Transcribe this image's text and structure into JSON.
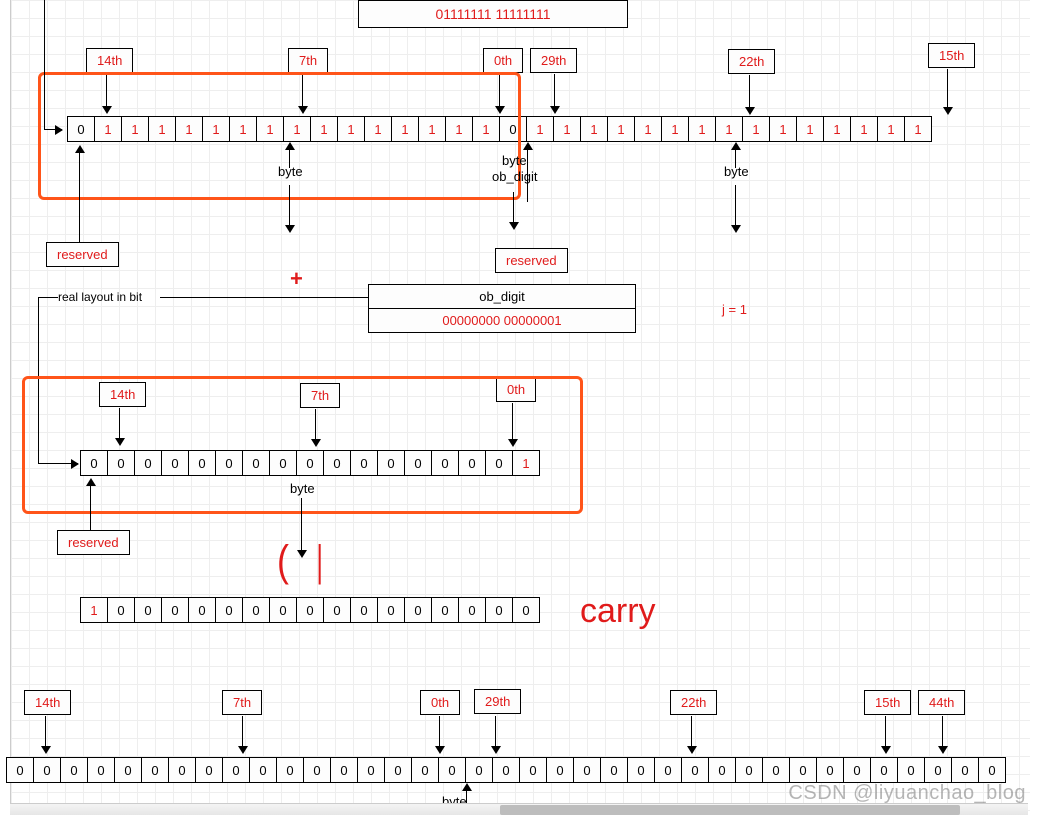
{
  "top_bin_box": "01111111 11111111",
  "ob_digit_label": "ob_digit",
  "ob_digit_value2": "00000000 00000001",
  "real_layout_label": "real layout in bit",
  "byte_label": "byte",
  "byte_obdigit_label1": "byte",
  "byte_obdigit_label2": "ob_digit",
  "reserved_label": "reserved",
  "j_label": "j = 1",
  "plus": "+",
  "carry": "carry",
  "watermark": "CSDN @liyuanchao_blog",
  "markers": {
    "m14": "14th",
    "m7": "7th",
    "m0": "0th",
    "m29": "29th",
    "m22": "22th",
    "m15": "15th",
    "m44": "44th"
  },
  "row1": [
    "0",
    "1",
    "1",
    "1",
    "1",
    "1",
    "1",
    "1",
    "1",
    "1",
    "1",
    "1",
    "1",
    "1",
    "1",
    "1",
    "0",
    "1",
    "1",
    "1",
    "1",
    "1",
    "1",
    "1",
    "1",
    "1",
    "1",
    "1",
    "1",
    "1",
    "1",
    "1"
  ],
  "row1_red": [
    0,
    1,
    1,
    1,
    1,
    1,
    1,
    1,
    1,
    1,
    1,
    1,
    1,
    1,
    1,
    1,
    0,
    1,
    1,
    1,
    1,
    1,
    1,
    1,
    1,
    1,
    1,
    1,
    1,
    1,
    1,
    1
  ],
  "row2": [
    "0",
    "0",
    "0",
    "0",
    "0",
    "0",
    "0",
    "0",
    "0",
    "0",
    "0",
    "0",
    "0",
    "0",
    "0",
    "0",
    "1"
  ],
  "row2_red": [
    0,
    0,
    0,
    0,
    0,
    0,
    0,
    0,
    0,
    0,
    0,
    0,
    0,
    0,
    0,
    0,
    1
  ],
  "row3": [
    "1",
    "0",
    "0",
    "0",
    "0",
    "0",
    "0",
    "0",
    "0",
    "0",
    "0",
    "0",
    "0",
    "0",
    "0",
    "0",
    "0"
  ],
  "row3_red": [
    1,
    0,
    0,
    0,
    0,
    0,
    0,
    0,
    0,
    0,
    0,
    0,
    0,
    0,
    0,
    0,
    0
  ],
  "row4": [
    "0",
    "0",
    "0",
    "0",
    "0",
    "0",
    "0",
    "0",
    "0",
    "0",
    "0",
    "0",
    "0",
    "0",
    "0",
    "0",
    "0",
    "0",
    "0",
    "0",
    "0",
    "0",
    "0",
    "0",
    "0",
    "0",
    "0",
    "0",
    "0",
    "0",
    "0",
    "0",
    "0",
    "0",
    "0",
    "0",
    "0"
  ]
}
